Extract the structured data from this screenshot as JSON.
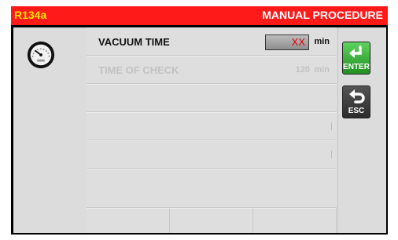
{
  "header": {
    "model": "R134a",
    "title": "MANUAL PROCEDURE"
  },
  "rows": [
    {
      "label": "VACUUM TIME",
      "value": "XX",
      "unit": "min"
    },
    {
      "label": "TIME OF  CHECK",
      "value": "120",
      "unit": "min"
    }
  ],
  "buttons": {
    "enter_label": "ENTER",
    "esc_label": "ESC"
  },
  "icons": {
    "gauge": "vacuum-gauge-icon",
    "enter": "enter-arrow-icon",
    "esc": "back-arrow-icon"
  },
  "colors": {
    "title_bar": "#ff1a1a",
    "model_text": "#ffe600",
    "value_text": "#e30000",
    "enter_button": "#2fb32f"
  }
}
